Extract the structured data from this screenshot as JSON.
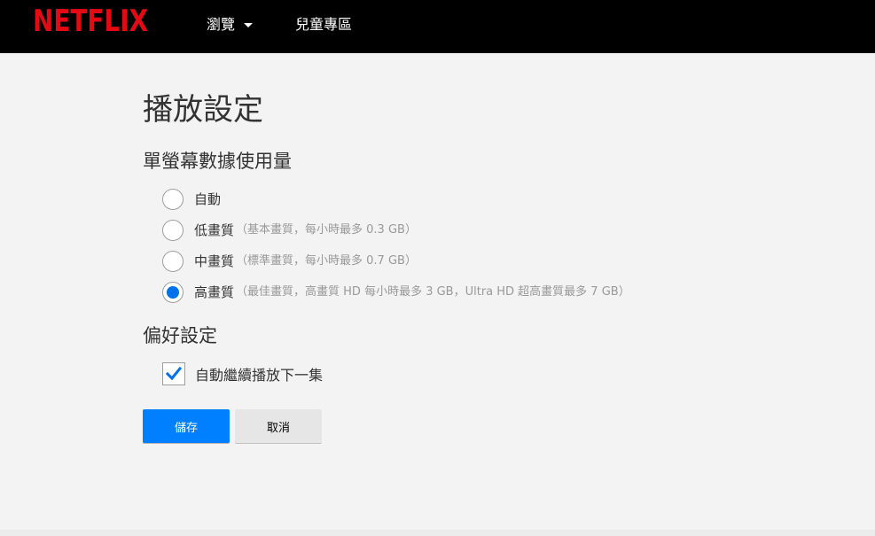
{
  "header": {
    "logo": "NETFLIX",
    "nav": [
      {
        "label": "瀏覽"
      },
      {
        "label": "兒童專區"
      }
    ]
  },
  "page": {
    "title": "播放設定"
  },
  "data_usage": {
    "title": "單螢幕數據使用量",
    "options": [
      {
        "label": "自動",
        "desc": "",
        "selected": false
      },
      {
        "label": "低畫質",
        "desc": "（基本畫質，每小時最多 0.3 GB）",
        "selected": false
      },
      {
        "label": "中畫質",
        "desc": "（標準畫質，每小時最多 0.7 GB）",
        "selected": false
      },
      {
        "label": "高畫質",
        "desc": "（最佳畫質，高畫質 HD 每小時最多 3 GB，Ultra HD 超高畫質最多 7 GB）",
        "selected": true
      }
    ]
  },
  "preferences": {
    "title": "偏好設定",
    "autoplay_label": "自動繼續播放下一集",
    "autoplay_checked": true
  },
  "actions": {
    "save_label": "儲存",
    "cancel_label": "取消"
  },
  "colors": {
    "brand": "#e50914",
    "accent": "#0080ff"
  },
  "icons": {
    "nav_dropdown": "caret-down-icon",
    "checkbox_mark": "checkmark-icon"
  }
}
